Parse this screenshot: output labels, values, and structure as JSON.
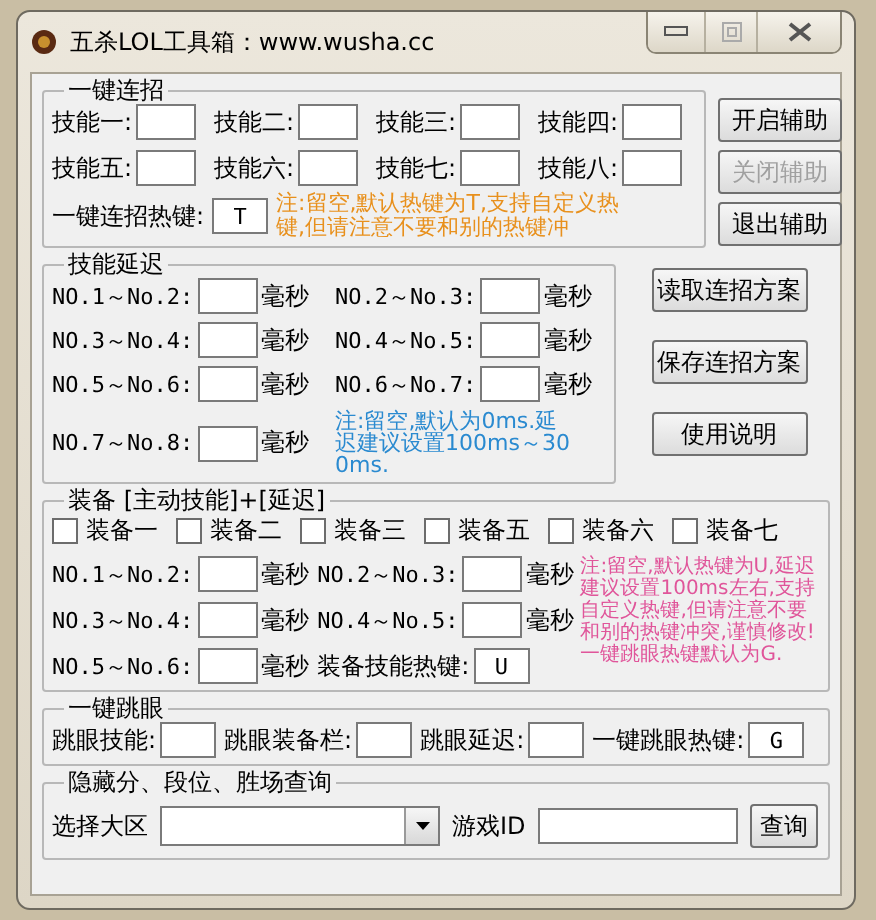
{
  "window": {
    "title": "五杀LOL工具箱：www.wusha.cc"
  },
  "combo": {
    "title": "一键连招",
    "skills": [
      {
        "label": "技能一:"
      },
      {
        "label": "技能二:"
      },
      {
        "label": "技能三:"
      },
      {
        "label": "技能四:"
      },
      {
        "label": "技能五:"
      },
      {
        "label": "技能六:"
      },
      {
        "label": "技能七:"
      },
      {
        "label": "技能八:"
      }
    ],
    "hotkey": {
      "label": "一键连招热键:",
      "value": "T"
    },
    "note": "注:留空,默认热键为T,支持自定义热键,但请注意不要和别的热键冲"
  },
  "side_buttons": [
    {
      "label": "开启辅助",
      "disabled": false
    },
    {
      "label": "关闭辅助",
      "disabled": true
    },
    {
      "label": "退出辅助",
      "disabled": false
    }
  ],
  "delay": {
    "title": "技能延迟",
    "rows": [
      {
        "label": "NO.1～No.2:",
        "unit": "毫秒"
      },
      {
        "label": "NO.2～No.3:",
        "unit": "毫秒"
      },
      {
        "label": "NO.3～No.4:",
        "unit": "毫秒"
      },
      {
        "label": "NO.4～No.5:",
        "unit": "毫秒"
      },
      {
        "label": "NO.5～No.6:",
        "unit": "毫秒"
      },
      {
        "label": "NO.6～No.7:",
        "unit": "毫秒"
      },
      {
        "label": "NO.7～No.8:",
        "unit": "毫秒"
      }
    ],
    "note": "注:留空,默认为0ms.延迟建议设置100ms～300ms."
  },
  "scheme_buttons": [
    {
      "label": "读取连招方案"
    },
    {
      "label": "保存连招方案"
    },
    {
      "label": "使用说明"
    }
  ],
  "equipment": {
    "title": "装备 [主动技能]+[延迟]",
    "items": [
      {
        "label": "装备一",
        "checked": false
      },
      {
        "label": "装备二",
        "checked": false
      },
      {
        "label": "装备三",
        "checked": false
      },
      {
        "label": "装备五",
        "checked": false
      },
      {
        "label": "装备六",
        "checked": false
      },
      {
        "label": "装备七",
        "checked": false
      }
    ],
    "rows": [
      {
        "label": "NO.1～No.2:",
        "unit": "毫秒"
      },
      {
        "label": "NO.2～No.3:",
        "unit": "毫秒"
      },
      {
        "label": "NO.3～No.4:",
        "unit": "毫秒"
      },
      {
        "label": "NO.4～No.5:",
        "unit": "毫秒"
      },
      {
        "label": "NO.5～No.6:",
        "unit": "毫秒"
      }
    ],
    "hotkey": {
      "label": "装备技能热键:",
      "value": "U"
    },
    "note": "注:留空,默认热键为U,延迟建议设置100ms左右,支持自定义热键,但请注意不要和别的热键冲突,谨慎修改!一键跳眼热键默认为G."
  },
  "ward": {
    "title": "一键跳眼",
    "fields": [
      {
        "label": "跳眼技能:"
      },
      {
        "label": "跳眼装备栏:"
      },
      {
        "label": "跳眼延迟:"
      },
      {
        "label": "一键跳眼热键:",
        "value": "G"
      }
    ]
  },
  "query": {
    "title": "隐藏分、段位、胜场查询",
    "region_label": "选择大区",
    "id_label": "游戏ID",
    "button": "查询"
  }
}
